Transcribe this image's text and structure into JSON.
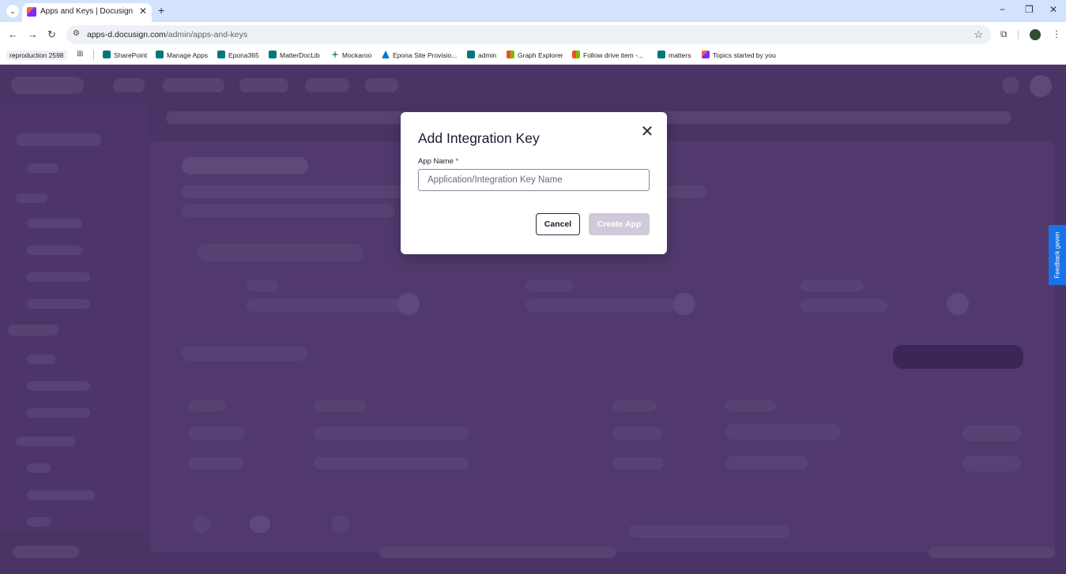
{
  "browser": {
    "tab": {
      "title": "Apps and Keys | Docusign",
      "close": "✕"
    },
    "new_tab": "+",
    "window": {
      "minimize": "−",
      "restore": "❐",
      "close": "✕"
    },
    "nav": {
      "back": "←",
      "forward": "→",
      "reload": "↻"
    },
    "url_host": "apps-d.docusign.com",
    "url_path": "/admin/apps-and-keys",
    "bookmarks": {
      "first": "reproduction 2598",
      "items": [
        {
          "label": "SharePoint",
          "icon": "sharepoint-icon"
        },
        {
          "label": "Manage Apps",
          "icon": "sharepoint-icon"
        },
        {
          "label": "Epona365",
          "icon": "sharepoint-icon"
        },
        {
          "label": "MatterDocLib",
          "icon": "sharepoint-icon"
        },
        {
          "label": "Mockaroo",
          "icon": "mockaroo-icon"
        },
        {
          "label": "Epona Site Provisio...",
          "icon": "azure-icon"
        },
        {
          "label": "admin",
          "icon": "sharepoint-icon"
        },
        {
          "label": "Graph Explorer",
          "icon": "microsoft-icon"
        },
        {
          "label": "Follow drive item -...",
          "icon": "microsoft-icon"
        },
        {
          "label": "matters",
          "icon": "sharepoint-icon"
        },
        {
          "label": "Topics started by you",
          "icon": "docusign-icon"
        }
      ]
    }
  },
  "feedback_tab": "Feedback geven",
  "modal": {
    "title": "Add Integration Key",
    "field_label": "App Name",
    "required_marker": "*",
    "input_placeholder": "Application/Integration Key Name",
    "input_value": "",
    "cancel_label": "Cancel",
    "create_label": "Create App",
    "create_enabled": false
  },
  "colors": {
    "overlay": "#4a3466",
    "feedback": "#1a73e8",
    "create_disabled": "#cfc9d9",
    "required": "#c8102e"
  }
}
